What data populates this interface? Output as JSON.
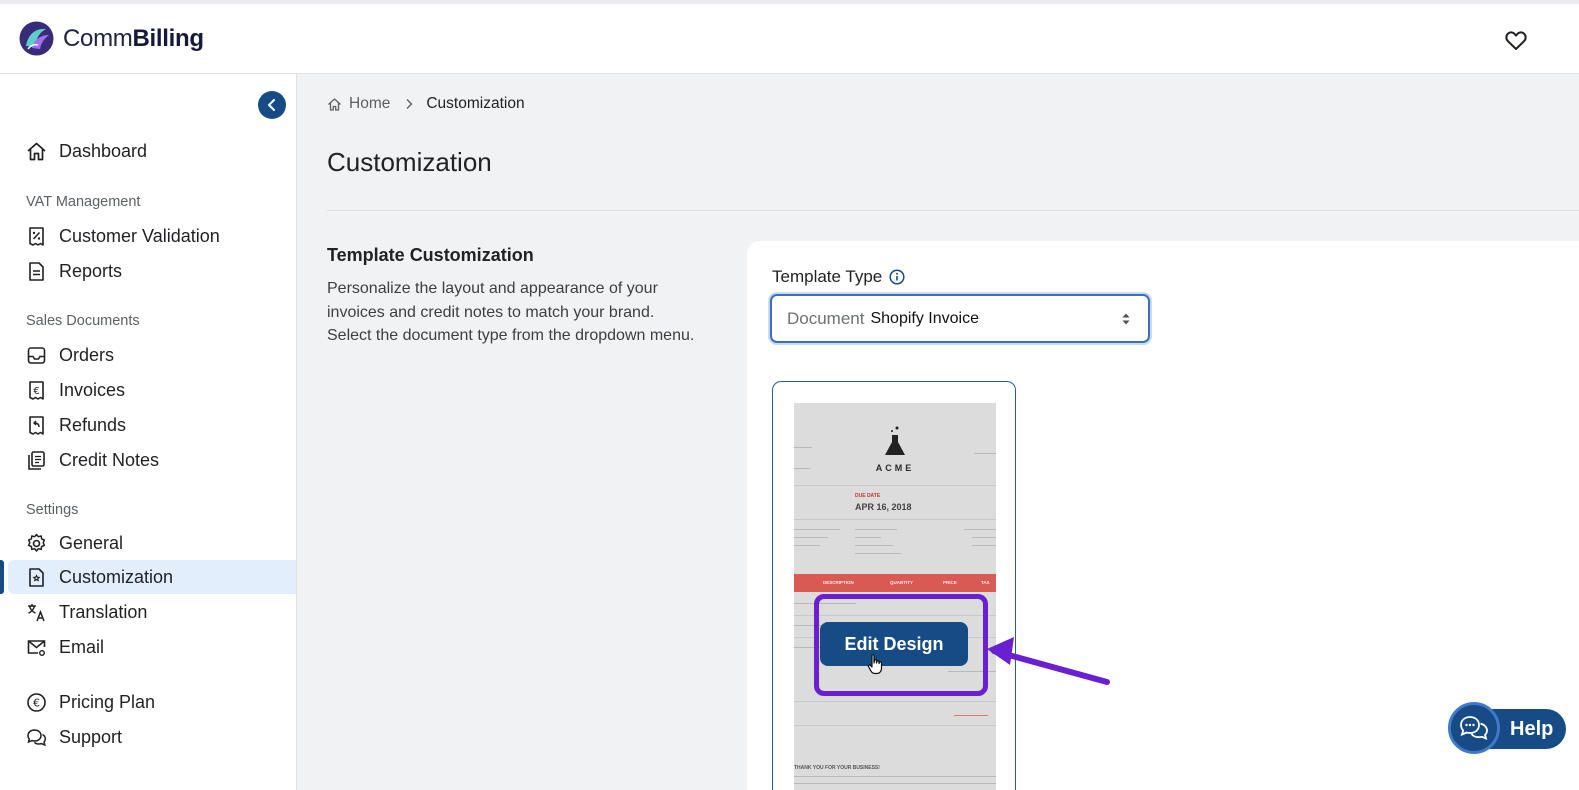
{
  "app": {
    "brand_light": "Comm",
    "brand_bold": "Billing",
    "accent_color": "#164b86",
    "highlight_color": "#6a1fd1"
  },
  "header": {
    "icons": [
      "favorite-heart-icon"
    ]
  },
  "sidebar": {
    "items": [
      {
        "label": "Dashboard",
        "icon": "home-icon"
      },
      {
        "section": "VAT Management"
      },
      {
        "label": "Customer Validation",
        "icon": "receipt-percent-icon"
      },
      {
        "label": "Reports",
        "icon": "document-icon"
      },
      {
        "section": "Sales Documents"
      },
      {
        "label": "Orders",
        "icon": "inbox-icon"
      },
      {
        "label": "Invoices",
        "icon": "euro-receipt-icon"
      },
      {
        "label": "Refunds",
        "icon": "refund-receipt-icon"
      },
      {
        "label": "Credit Notes",
        "icon": "documents-stack-icon"
      },
      {
        "section": "Settings"
      },
      {
        "label": "General",
        "icon": "gear-icon"
      },
      {
        "label": "Customization",
        "icon": "custom-document-icon",
        "active": true
      },
      {
        "label": "Translation",
        "icon": "translate-icon"
      },
      {
        "label": "Email",
        "icon": "mail-gear-icon"
      },
      {
        "label": "Pricing Plan",
        "icon": "euro-circle-icon"
      },
      {
        "label": "Support",
        "icon": "chat-bubbles-icon"
      }
    ]
  },
  "breadcrumb": {
    "home": "Home",
    "current": "Customization"
  },
  "page": {
    "title": "Customization"
  },
  "template_section": {
    "title": "Template Customization",
    "description": "Personalize the layout and appearance of your invoices and credit notes to match your brand. Select the document type from the dropdown menu."
  },
  "template_type": {
    "label": "Template Type",
    "prefix": "Document",
    "selected": "Shopify Invoice"
  },
  "preview": {
    "brand": "ACME",
    "due_label": "DUE DATE",
    "due_date": "APR 16, 2018",
    "columns": [
      "DESCRIPTION",
      "QUANTITY",
      "PRICE",
      "TAX"
    ],
    "footer": "THANK YOU FOR YOUR BUSINESS!"
  },
  "edit_button": {
    "label": "Edit Design"
  },
  "help": {
    "label": "Help"
  }
}
